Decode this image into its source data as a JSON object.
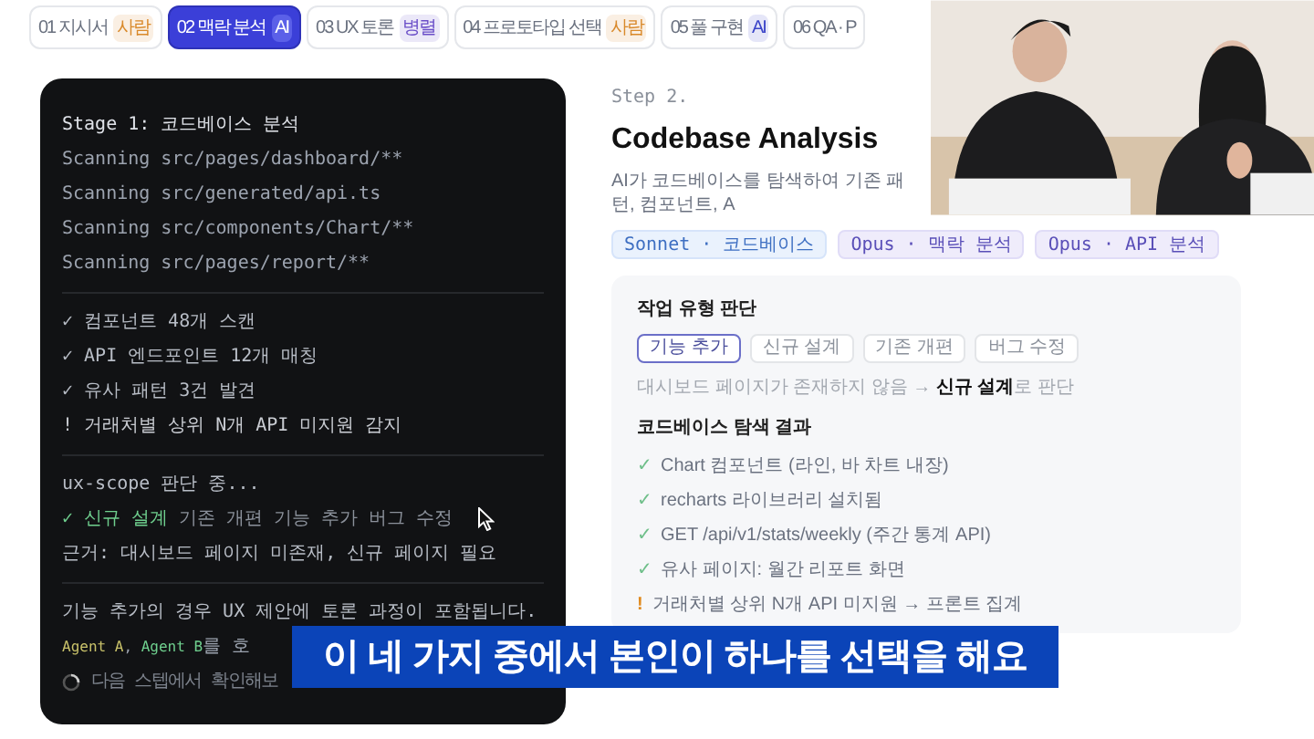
{
  "tabs": [
    {
      "label": "01 지시서",
      "badge": "사람",
      "color": "#d9892a",
      "selected": false
    },
    {
      "label": "02 맥락 분석",
      "badge": "AI",
      "color": "#5b60e8",
      "selected": true
    },
    {
      "label": "03 UX 토론",
      "badge": "병렬",
      "color": "#6b4fc8",
      "selected": false
    },
    {
      "label": "04 프로토타입 선택",
      "badge": "사람",
      "color": "#d9892a",
      "selected": false
    },
    {
      "label": "05 풀 구현",
      "badge": "AI",
      "color": "#3b44c8",
      "selected": false
    },
    {
      "label": "06 QA · P",
      "selected": false
    }
  ],
  "terminal": {
    "stage_title": "Stage 1: 코드베이스 분석",
    "scans": [
      "Scanning src/pages/dashboard/**",
      "Scanning src/generated/api.ts",
      "Scanning src/components/Chart/**",
      "Scanning src/pages/report/**"
    ],
    "results": [
      {
        "kind": "check",
        "mark": "✓",
        "text": "컴포넌트 48개 스캔"
      },
      {
        "kind": "check",
        "mark": "✓",
        "text": "API 엔드포인트 12개 매칭"
      },
      {
        "kind": "check",
        "mark": "✓",
        "text": "유사 패턴 3건 발견"
      },
      {
        "kind": "warn",
        "mark": "!",
        "text": "거래처별 상위 N개 API 미지원 감지"
      }
    ],
    "scope_status": "ux-scope 판단 중...",
    "scope_mark": "✓",
    "scope_options": [
      {
        "label": "신규 설계",
        "selected": true
      },
      {
        "label": "기존 개편",
        "selected": false
      },
      {
        "label": "기능 추가",
        "selected": false
      },
      {
        "label": "버그 수정",
        "selected": false
      }
    ],
    "rationale": "근거: 대시보드 페이지 미존재, 신규 페이지 필요",
    "note": "기능 추가의 경우 UX 제안에 토론 과정이 포함됩니다.",
    "agents_line": [
      {
        "text": "Agent A",
        "color": "#c9c26a"
      },
      {
        "text": ", ",
        "color": "#9ca3af"
      },
      {
        "text": "Agent B",
        "color": "#6fcf8e"
      },
      {
        "text": "를 호",
        "color": "#9ca3af"
      }
    ],
    "pending": "다음 스텝에서 확인해보"
  },
  "step": {
    "label": "Step 2.",
    "title": "Codebase Analysis",
    "description": "AI가 코드베이스를 탐색하여 기존 패턴, 컴포넌트, A"
  },
  "models": [
    {
      "label": "Sonnet · 코드베이스",
      "kind": "sonnet"
    },
    {
      "label": "Opus · 맥락 분석",
      "kind": "opus"
    },
    {
      "label": "Opus · API 분석",
      "kind": "opus"
    }
  ],
  "card": {
    "task_type": {
      "title": "작업 유형 판단",
      "options": [
        {
          "label": "기능 추가",
          "selected": true
        },
        {
          "label": "신규 설계",
          "selected": false
        },
        {
          "label": "기존 개편",
          "selected": false
        },
        {
          "label": "버그 수정",
          "selected": false
        }
      ],
      "note": "대시보드 페이지가 존재하지 않음 → **신규 설계**로 판단"
    },
    "findings": {
      "title": "코드베이스 탐색 결과",
      "items": [
        {
          "kind": "check",
          "mark": "✓",
          "text": "Chart 컴포넌트 (라인, 바 차트 내장)"
        },
        {
          "kind": "check",
          "mark": "✓",
          "text": "recharts 라이브러리 설치됨"
        },
        {
          "kind": "check",
          "mark": "✓",
          "text": "GET /api/v1/stats/weekly (주간 통계 API)"
        },
        {
          "kind": "check",
          "mark": "✓",
          "text": "유사 페이지: 월간 리포트 화면"
        },
        {
          "kind": "warn",
          "mark": "!",
          "text": "거래처별 상위 N개 API 미지원 → 프론트 집계"
        }
      ]
    }
  },
  "subtitle": {
    "text": "이 네 가지 중에서 본인이 하나를 선택을 해요"
  }
}
